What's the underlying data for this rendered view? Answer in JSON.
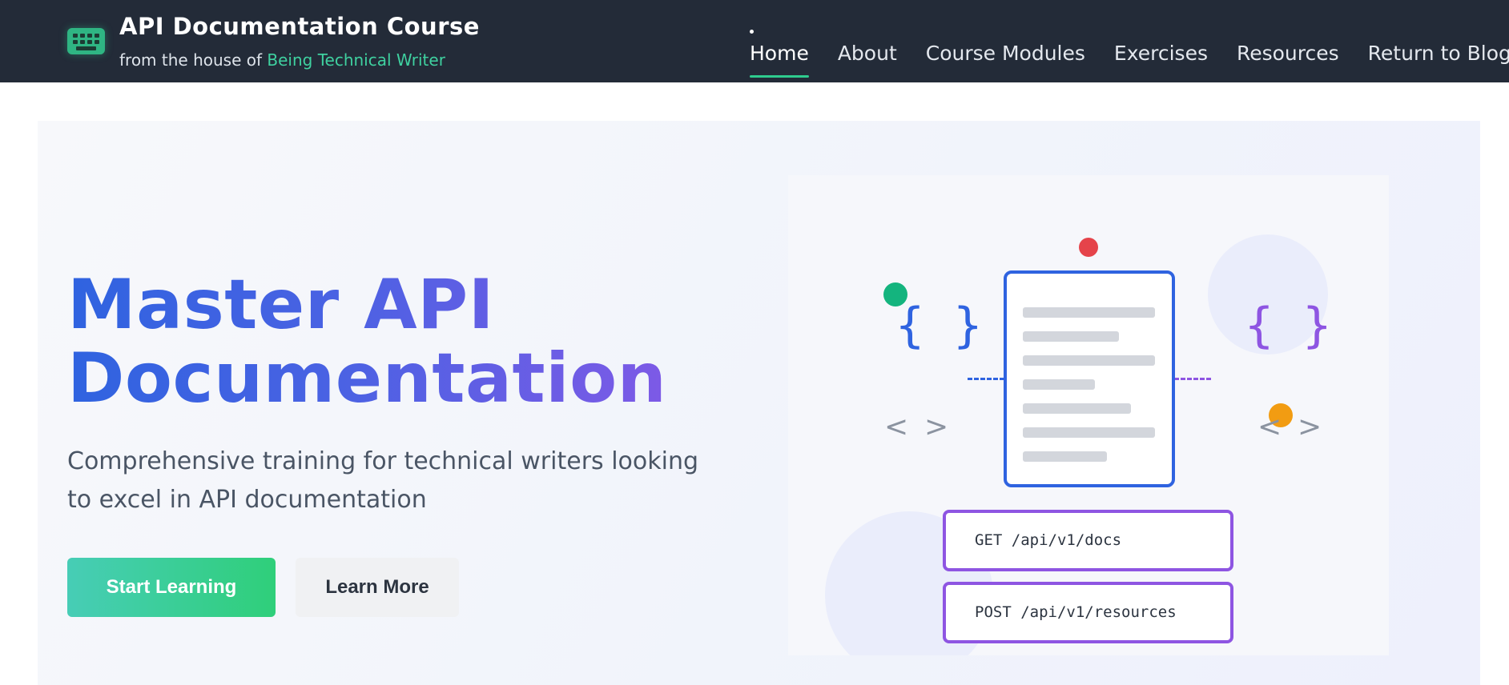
{
  "header": {
    "title": "API Documentation Course",
    "subtitle_prefix": "from the house of",
    "subtitle_link": "Being Technical Writer",
    "nav": [
      {
        "label": "Home",
        "active": true
      },
      {
        "label": "About"
      },
      {
        "label": "Course Modules"
      },
      {
        "label": "Exercises"
      },
      {
        "label": "Resources"
      },
      {
        "label": "Return to Blog"
      }
    ]
  },
  "hero": {
    "title_line1": "Master API",
    "title_line2": "Documentation",
    "description": "Comprehensive training for technical writers looking to excel in API documentation",
    "primary_button": "Start Learning",
    "secondary_button": "Learn More"
  },
  "illustration": {
    "brace_text": "{ }",
    "chevron_left": "<",
    "chevron_right": ">",
    "endpoints": [
      "GET /api/v1/docs",
      "POST /api/v1/resources"
    ]
  },
  "colors": {
    "header_bg": "#232b38",
    "accent_green": "#2ecc8e",
    "title_blue": "#2f63e0",
    "title_purple": "#7d5ae6",
    "endpoint_border": "#8e55e2",
    "dot_red": "#e5434a",
    "dot_green": "#14b47e",
    "dot_orange": "#f29c12"
  },
  "icons": {
    "brand": "keyboard-icon"
  }
}
